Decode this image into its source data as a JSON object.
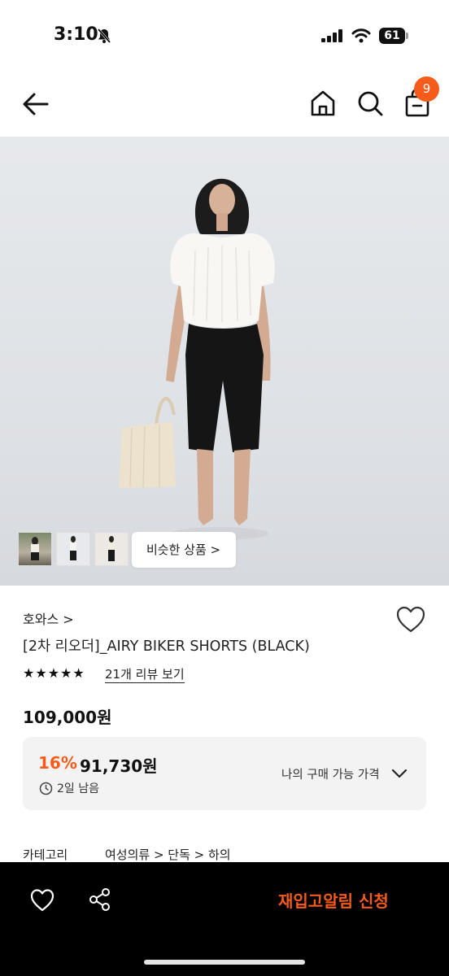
{
  "status_bar": {
    "time": "3:10",
    "battery": "61"
  },
  "header": {
    "icons": [
      "back-arrow-icon",
      "home-icon",
      "search-icon",
      "shopping-bag-icon"
    ],
    "cart_badge": "9"
  },
  "gallery": {
    "similar_button": "비슷한 상품 >"
  },
  "product": {
    "brand": "호와스 >",
    "title": "[2차 리오더]_AIRY BIKER SHORTS (BLACK)",
    "rating_stars": 5,
    "reviews_link": "21개 리뷰 보기",
    "price": "109,000원",
    "discount": {
      "percent": "16%",
      "price": "91,730원",
      "time_left": "2일 남음",
      "my_price_label": "나의 구매 가능 가격"
    },
    "category": {
      "label": "카테고리",
      "path": "여성의류 > 단독 > 하의"
    }
  },
  "bottom_bar": {
    "restock_button": "재입고알림 신청"
  },
  "colors": {
    "accent": "#f55b1a",
    "bottom_bar": "#000000",
    "deal_box": "#f3f3f3"
  }
}
